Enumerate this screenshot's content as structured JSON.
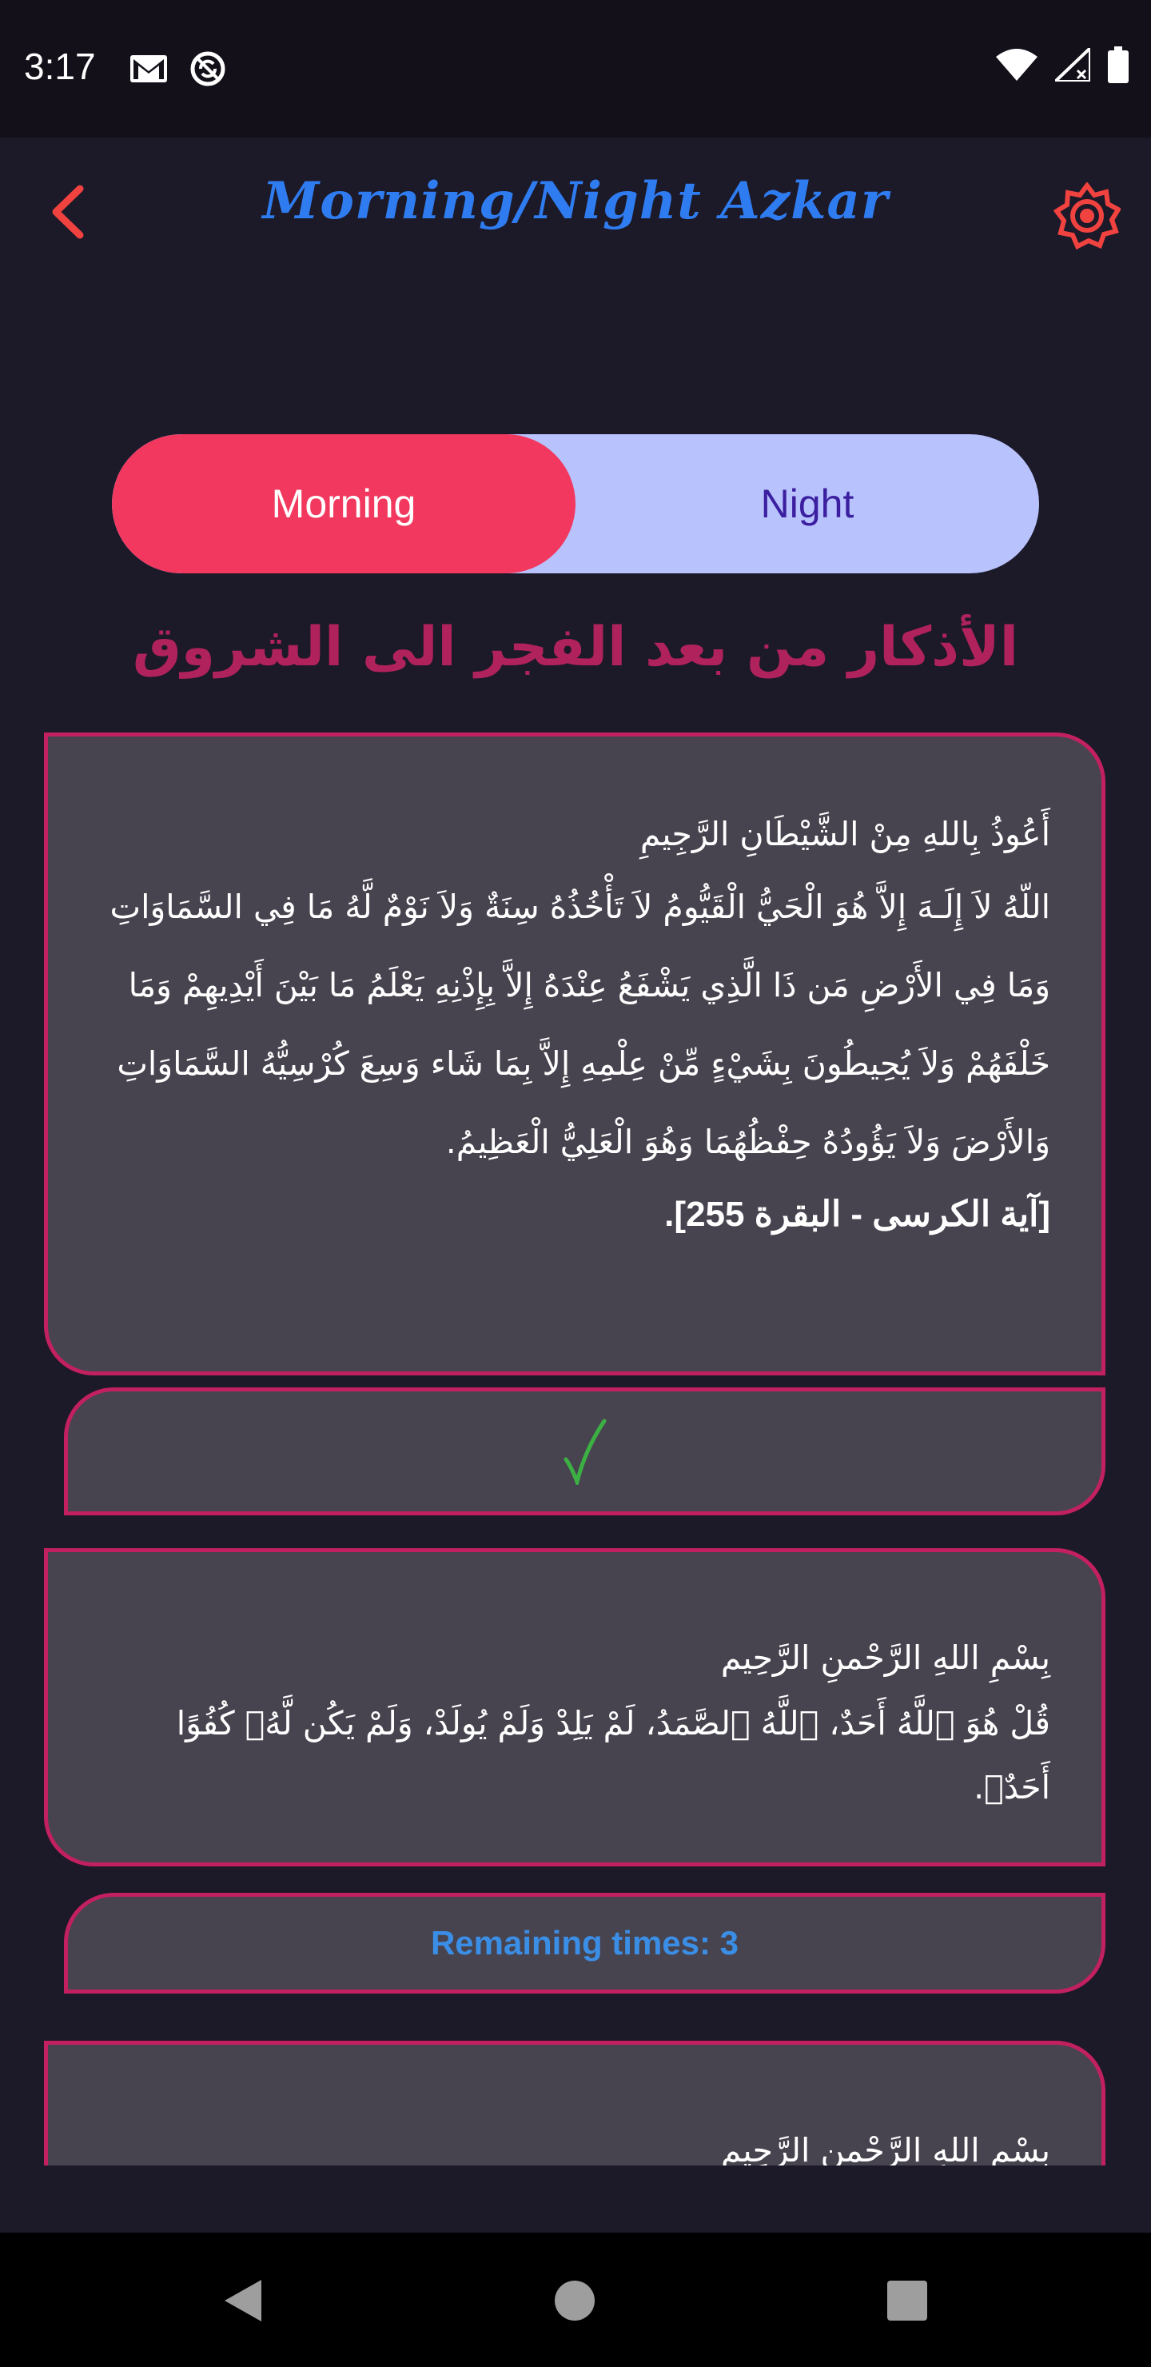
{
  "status_bar": {
    "time": "3:17",
    "left_icons": [
      "gmail-icon",
      "sync-icon"
    ],
    "right_icons": [
      "wifi-icon",
      "signal-icon",
      "battery-icon"
    ]
  },
  "app_bar": {
    "title": "Morning/Night Azkar",
    "back_icon": "chevron-left-icon",
    "settings_icon": "gear-icon",
    "accent_color": "#f0423f",
    "title_color": "#2f7cf0"
  },
  "toggle": {
    "morning_label": "Morning",
    "night_label": "Night",
    "selected": "Morning",
    "active_color": "#f2385e",
    "inactive_color": "#b8c2fd"
  },
  "section_heading": "الأذكار من بعد الفجر الى الشروق",
  "cards": [
    {
      "opening": "أَعُوذُ بِاللهِ مِنْ الشَّيْطَانِ الرَّجِيمِ",
      "body": "اللّهُ لاَ إِلَـهَ إِلاَّ هُوَ الْحَيُّ الْقَيُّومُ لاَ تَأْخُذُهُ سِنَةٌ وَلاَ نَوْمٌ لَّهُ مَا فِي السَّمَاوَاتِ وَمَا فِي الأَرْضِ مَن ذَا الَّذِي يَشْفَعُ عِنْدَهُ إِلاَّ بِإِذْنِهِ يَعْلَمُ مَا بَيْنَ أَيْدِيهِمْ وَمَا خَلْفَهُمْ وَلاَ يُحِيطُونَ بِشَيْءٍ مِّنْ عِلْمِهِ إِلاَّ بِمَا شَاء وَسِعَ كُرْسِيُّهُ السَّمَاوَاتِ وَالأَرْضَ وَلاَ يَؤُودُهُ حِفْظُهُمَا وَهُوَ الْعَلِيُّ الْعَظِيمُ.",
      "reference": "[آية الكرسى - البقرة 255].",
      "counter_done": true,
      "counter_text": "✓"
    },
    {
      "opening": "بِسْمِ اللهِ الرَّحْمنِ الرَّحِيم",
      "body": "قُلْ هُوَ ٱللَّهُ أَحَدٌ، ٱللَّهُ ٱلصَّمَدُ، لَمْ يَلِدْ وَلَمْ يُولَدْ، وَلَمْ يَكُن لَّهُۥ كُفُوًا أَحَدٌۢ.",
      "counter_done": false,
      "counter_text": "Remaining times: 3"
    },
    {
      "opening": "بِسْمِ اللهِ الرَّحْمنِ الرَّحِيم"
    }
  ],
  "nav_bar": {
    "icons": [
      "back-triangle-icon",
      "home-circle-icon",
      "recents-square-icon"
    ]
  }
}
